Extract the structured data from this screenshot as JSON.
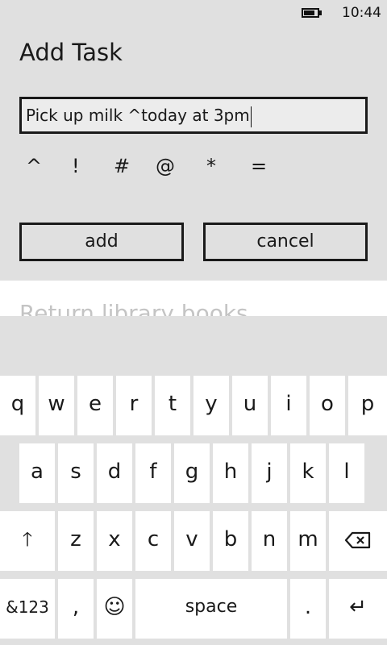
{
  "status_bar": {
    "time": "10:44",
    "battery_icon": "battery-icon"
  },
  "panel": {
    "title": "Add Task",
    "input_value": "Pick up milk ^today at 3pm",
    "symbols": [
      "^",
      "!",
      "#",
      "@",
      "*",
      "="
    ],
    "add_label": "add",
    "cancel_label": "cancel"
  },
  "list": {
    "item_text": "Return library books",
    "more_text": "..."
  },
  "keyboard": {
    "row1": [
      "q",
      "w",
      "e",
      "r",
      "t",
      "y",
      "u",
      "i",
      "o",
      "p"
    ],
    "row2": [
      "a",
      "s",
      "d",
      "f",
      "g",
      "h",
      "j",
      "k",
      "l"
    ],
    "row3": [
      "z",
      "x",
      "c",
      "v",
      "b",
      "n",
      "m"
    ],
    "shift_glyph": "🡑",
    "backspace_icon": "backspace-icon",
    "numbers_label": "&123",
    "comma_label": ",",
    "emoji_glyph": "☺",
    "space_label": "space",
    "period_label": ".",
    "enter_glyph": "↵"
  }
}
